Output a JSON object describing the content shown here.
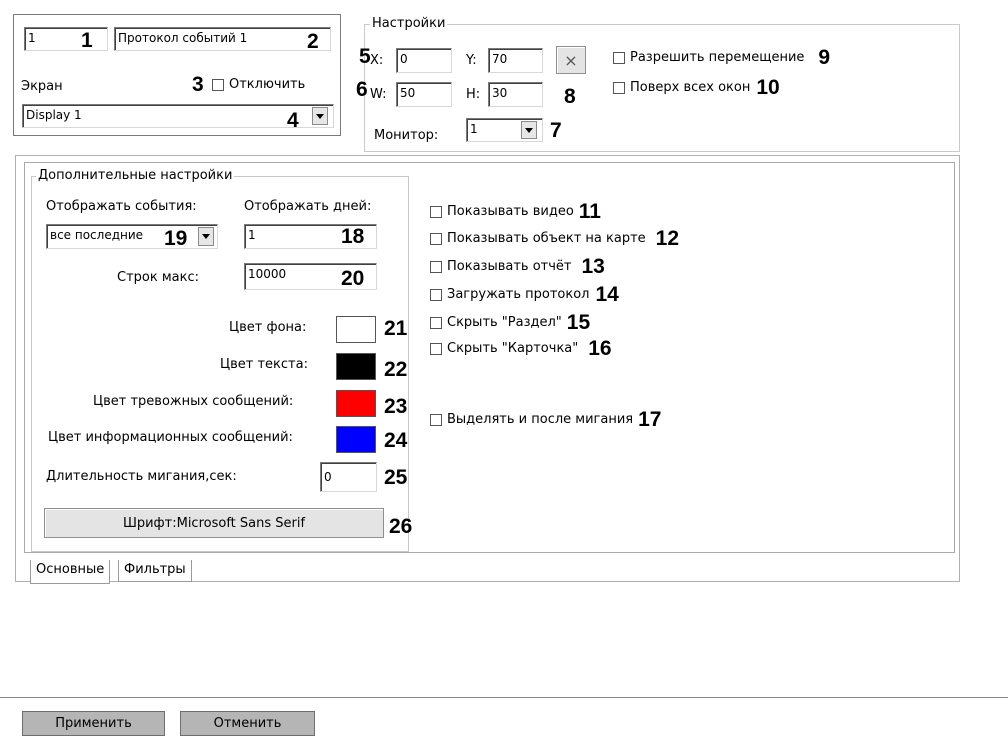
{
  "object_panel": {
    "id_value": "1",
    "name_value": "Протокол событий 1",
    "screen_label": "Экран",
    "disable_label": "Отключить",
    "display_value": "Display 1"
  },
  "settings": {
    "title": "Настройки",
    "x_label": "X:",
    "x_value": "0",
    "y_label": "Y:",
    "y_value": "70",
    "w_label": "W:",
    "w_value": "50",
    "h_label": "H:",
    "h_value": "30",
    "clear_button": "×",
    "allow_move_label": "Разрешить перемещение",
    "on_top_label": "Поверх всех окон",
    "monitor_label": "Монитор:",
    "monitor_value": "1"
  },
  "advanced": {
    "title": "Дополнительные настройки",
    "show_events_label": "Отображать события:",
    "show_events_value": "все последние",
    "show_days_label": "Отображать дней:",
    "show_days_value": "1",
    "max_rows_label": "Строк макс:",
    "max_rows_value": "10000",
    "bg_color_label": "Цвет фона:",
    "text_color_label": "Цвет текста:",
    "alarm_color_label": "Цвет тревожных сообщений:",
    "info_color_label": "Цвет информационных сообщений:",
    "blink_label": "Длительность мигания,сек:",
    "blink_value": "0",
    "font_button": "Шрифт:Microsoft Sans Serif",
    "colors": {
      "bg": "#ffffff",
      "text": "#000000",
      "alarm": "#ff0000",
      "info": "#0000ff"
    }
  },
  "options": {
    "show_video": "Показывать видео",
    "show_on_map": "Показывать объект на карте",
    "show_report": "Показывать отчёт",
    "load_protocol": "Загружать протокол",
    "hide_section": "Скрыть \"Раздел\"",
    "hide_card": "Скрыть \"Карточка\"",
    "highlight_after_blink": "Выделять и после мигания"
  },
  "tabs": {
    "main": "Основные",
    "filters": "Фильтры"
  },
  "callouts": {
    "n1": "1",
    "n2": "2",
    "n3": "3",
    "n4": "4",
    "n5": "5",
    "n6": "6",
    "n7": "7",
    "n8": "8",
    "n9": "9",
    "n10": "10",
    "n11": "11",
    "n12": "12",
    "n13": "13",
    "n14": "14",
    "n15": "15",
    "n16": "16",
    "n17": "17",
    "n18": "18",
    "n19": "19",
    "n20": "20",
    "n21": "21",
    "n22": "22",
    "n23": "23",
    "n24": "24",
    "n25": "25",
    "n26": "26"
  },
  "footer": {
    "apply": "Применить",
    "cancel": "Отменить"
  }
}
